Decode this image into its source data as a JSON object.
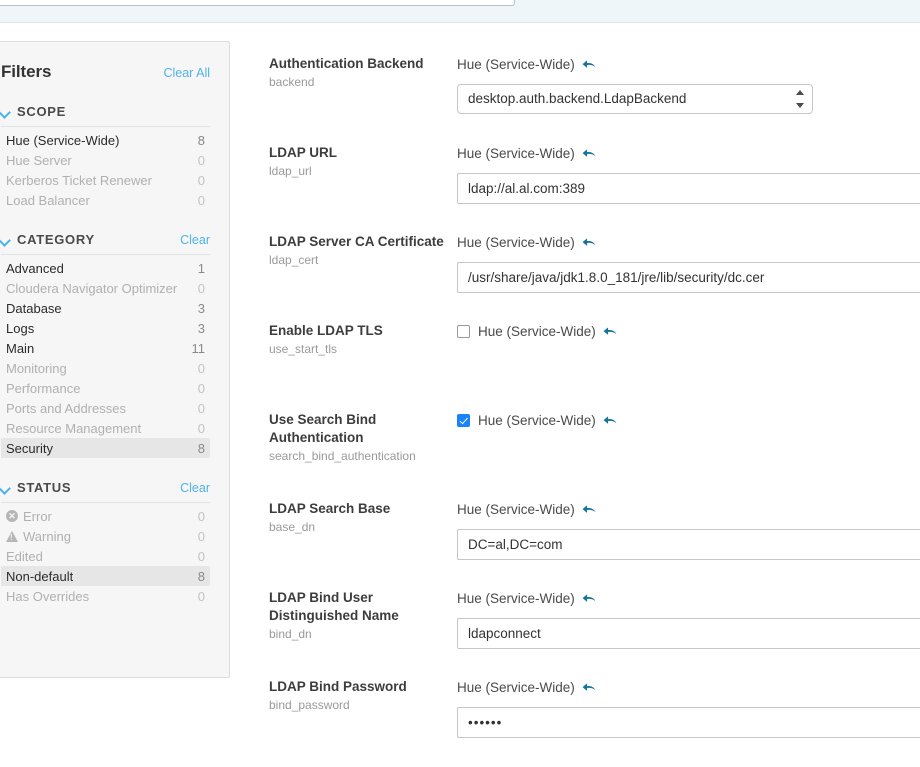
{
  "top_bar": {
    "search_value": "",
    "search_placeholder": ""
  },
  "filters": {
    "title": "Filters",
    "clear_all_label": "Clear All",
    "sections": [
      {
        "title": "SCOPE",
        "clear_label": "",
        "items": [
          {
            "label": "Hue (Service-Wide)",
            "count": "8",
            "state": "active"
          },
          {
            "label": "Hue Server",
            "count": "0",
            "state": "dim"
          },
          {
            "label": "Kerberos Ticket Renewer",
            "count": "0",
            "state": "dim"
          },
          {
            "label": "Load Balancer",
            "count": "0",
            "state": "dim"
          }
        ]
      },
      {
        "title": "CATEGORY",
        "clear_label": "Clear",
        "items": [
          {
            "label": "Advanced",
            "count": "1",
            "state": "active"
          },
          {
            "label": "Cloudera Navigator Optimizer",
            "count": "0",
            "state": "dim"
          },
          {
            "label": "Database",
            "count": "3",
            "state": "active"
          },
          {
            "label": "Logs",
            "count": "3",
            "state": "active"
          },
          {
            "label": "Main",
            "count": "11",
            "state": "active"
          },
          {
            "label": "Monitoring",
            "count": "0",
            "state": "dim"
          },
          {
            "label": "Performance",
            "count": "0",
            "state": "dim"
          },
          {
            "label": "Ports and Addresses",
            "count": "0",
            "state": "dim"
          },
          {
            "label": "Resource Management",
            "count": "0",
            "state": "dim"
          },
          {
            "label": "Security",
            "count": "8",
            "state": "selected"
          }
        ]
      },
      {
        "title": "STATUS",
        "clear_label": "Clear",
        "items": [
          {
            "label": "Error",
            "count": "0",
            "state": "dim",
            "icon": "error-circle-icon"
          },
          {
            "label": "Warning",
            "count": "0",
            "state": "dim",
            "icon": "warning-triangle-icon"
          },
          {
            "label": "Edited",
            "count": "0",
            "state": "dim",
            "icon": ""
          },
          {
            "label": "Non-default",
            "count": "8",
            "state": "selected",
            "icon": ""
          },
          {
            "label": "Has Overrides",
            "count": "0",
            "state": "dim",
            "icon": ""
          }
        ]
      }
    ]
  },
  "config": {
    "scope_label": "Hue (Service-Wide)",
    "undo_icon": "undo-arrow-icon",
    "rows": [
      {
        "name": "Authentication Backend",
        "key": "backend",
        "type": "select",
        "value": "desktop.auth.backend.LdapBackend"
      },
      {
        "name": "LDAP URL",
        "key": "ldap_url",
        "type": "text",
        "value": "ldap://al.al.com:389"
      },
      {
        "name": "LDAP Server CA Certificate",
        "key": "ldap_cert",
        "type": "text",
        "value": "/usr/share/java/jdk1.8.0_181/jre/lib/security/dc.cer"
      },
      {
        "name": "Enable LDAP TLS",
        "key": "use_start_tls",
        "type": "checkbox",
        "checked": false
      },
      {
        "name": "Use Search Bind Authentication",
        "key": "search_bind_authentication",
        "type": "checkbox",
        "checked": true
      },
      {
        "name": "LDAP Search Base",
        "key": "base_dn",
        "type": "text",
        "value": "DC=al,DC=com"
      },
      {
        "name": "LDAP Bind User Distinguished Name",
        "key": "bind_dn",
        "type": "text",
        "value": "ldapconnect"
      },
      {
        "name": "LDAP Bind Password",
        "key": "bind_password",
        "type": "password",
        "value": "••••••"
      }
    ]
  },
  "colors": {
    "accent_link": "#4fb3e8",
    "undo_arrow": "#16749b",
    "checkbox_checked": "#1a82fb",
    "selected_row_bg": "#e6e6e6",
    "top_bar_bg": "#eff6f9"
  }
}
